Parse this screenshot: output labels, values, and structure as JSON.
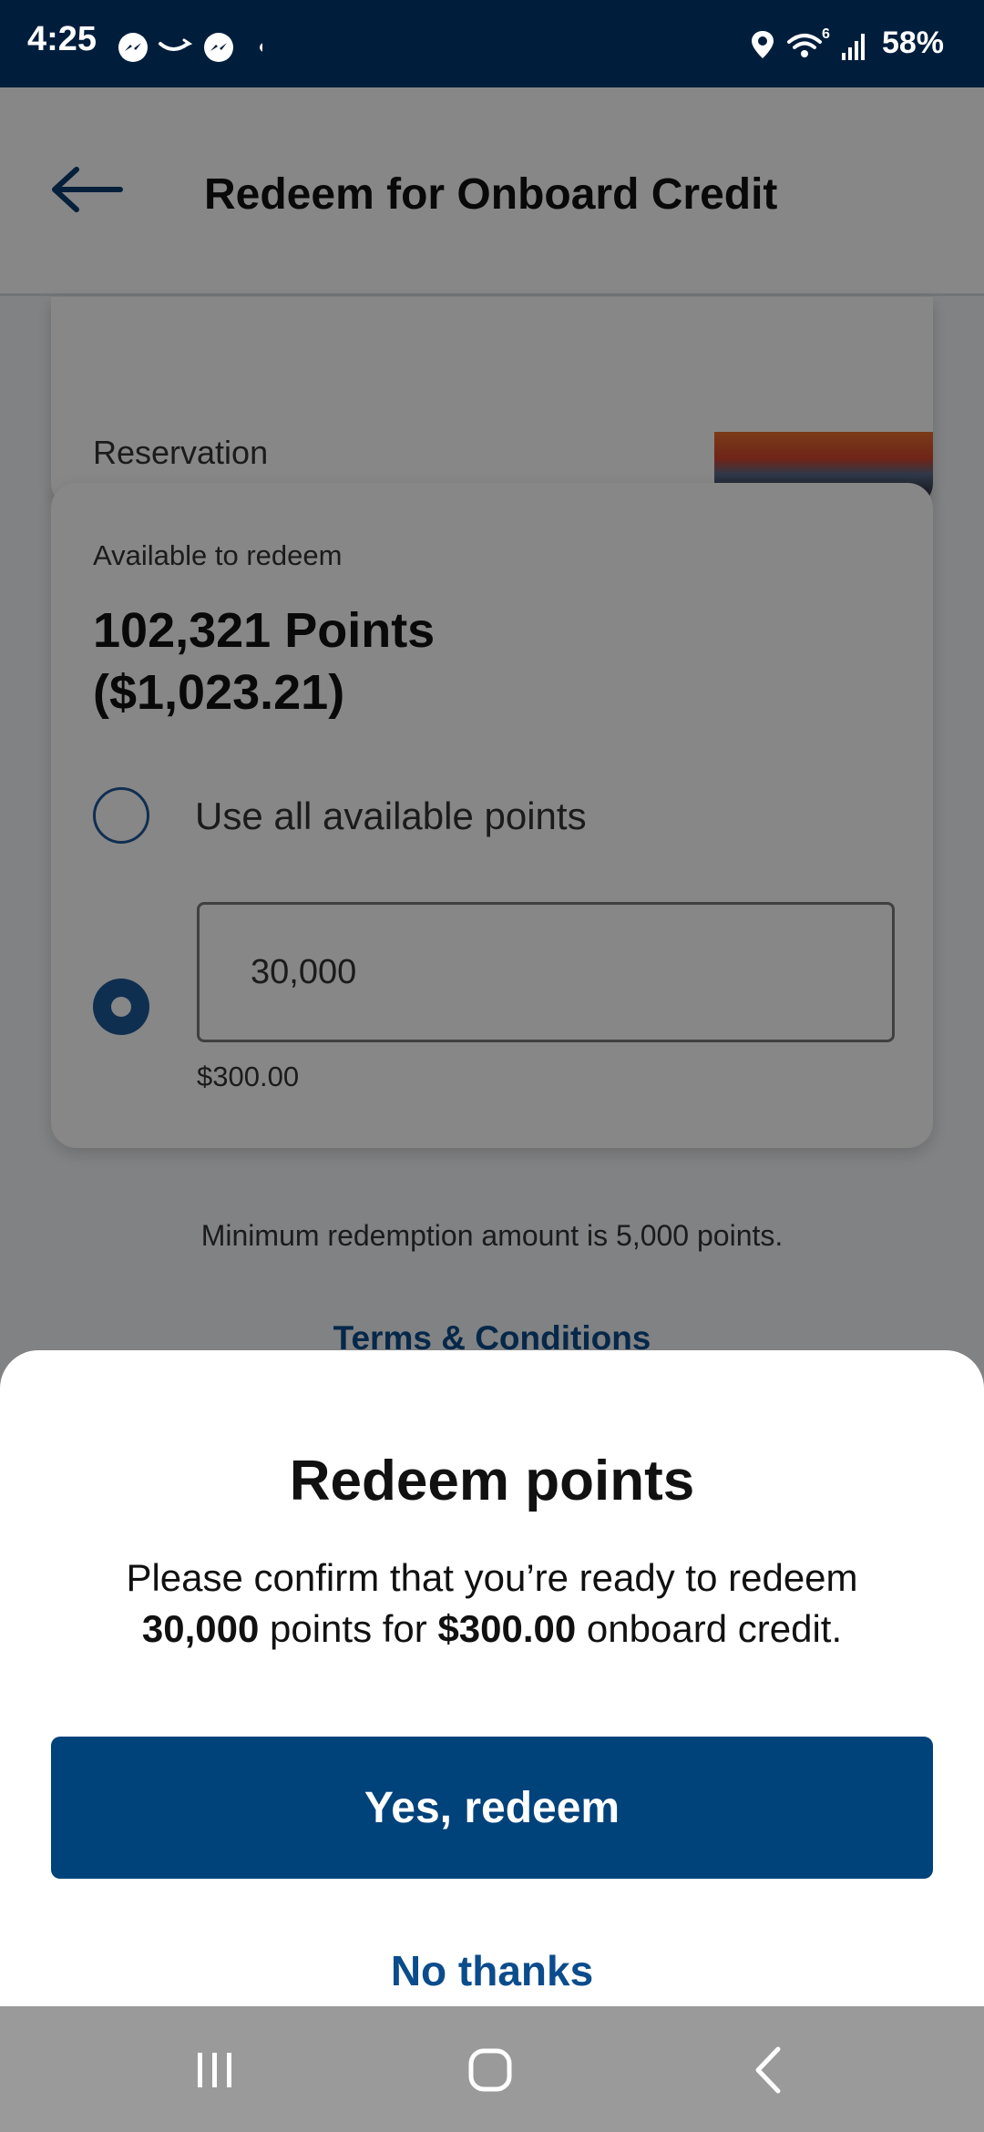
{
  "status_bar": {
    "time": "4:25",
    "battery": "58%",
    "wifi_badge": "6",
    "icons": [
      "messenger-icon",
      "amazon-icon",
      "messenger-icon",
      "dot-icon",
      "location-icon",
      "wifi-icon",
      "signal-icon"
    ]
  },
  "app_bar": {
    "title": "Redeem for Onboard Credit",
    "back_icon": "back-arrow-icon"
  },
  "reservation_card": {
    "label": "Reservation"
  },
  "redeem_card": {
    "available_label": "Available to redeem",
    "points_line": "102,321 Points",
    "value_line": "($1,023.21)",
    "use_all_label": "Use all available points",
    "input_value": "30,000",
    "input_dollar_value": "$300.00",
    "selected_option": "custom"
  },
  "minimum_note": "Minimum redemption amount is 5,000 points.",
  "terms_link": "Terms & Conditions",
  "sheet": {
    "title": "Redeem points",
    "msg_pre": "Please confirm that you’re ready to redeem ",
    "msg_points": "30,000",
    "msg_mid": " points for ",
    "msg_amount": "$300.00",
    "msg_post": " onboard credit.",
    "confirm_label": "Yes, redeem",
    "cancel_label": "No thanks"
  },
  "colors": {
    "primary": "#00427a",
    "link": "#0b4c8c",
    "status_bar": "#001e3c",
    "radio": "#1e5a9a"
  },
  "nav_bar": {
    "icons": [
      "recent-apps-icon",
      "home-icon",
      "back-icon"
    ]
  }
}
